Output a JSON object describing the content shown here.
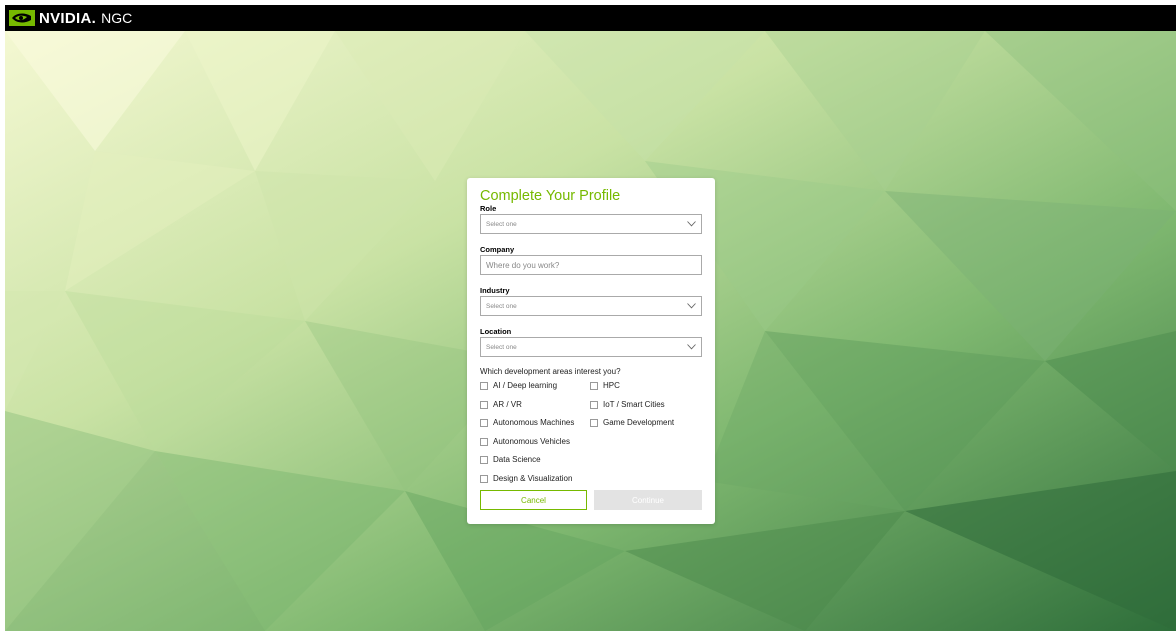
{
  "header": {
    "brand": "NVIDIA.",
    "product": "NGC"
  },
  "colors": {
    "accent": "#76b900",
    "topbar": "#000000",
    "button_disabled": "#e3e3e3"
  },
  "form": {
    "title": "Complete Your Profile",
    "role": {
      "label": "Role",
      "value": "Select one"
    },
    "company": {
      "label": "Company",
      "placeholder": "Where do you work?"
    },
    "industry": {
      "label": "Industry",
      "value": "Select one"
    },
    "location": {
      "label": "Location",
      "value": "Select one"
    },
    "question": "Which development areas interest you?",
    "areas": [
      {
        "label": "AI / Deep learning",
        "checked": false
      },
      {
        "label": "HPC",
        "checked": false
      },
      {
        "label": "AR / VR",
        "checked": false
      },
      {
        "label": "IoT / Smart Cities",
        "checked": false
      },
      {
        "label": "Autonomous Machines",
        "checked": false
      },
      {
        "label": "Game Development",
        "checked": false
      },
      {
        "label": "Autonomous Vehicles",
        "checked": false
      },
      {
        "label": "Data Science",
        "checked": false
      },
      {
        "label": "Design & Visualization",
        "checked": false
      }
    ],
    "cancel_label": "Cancel",
    "continue_label": "Continue"
  }
}
